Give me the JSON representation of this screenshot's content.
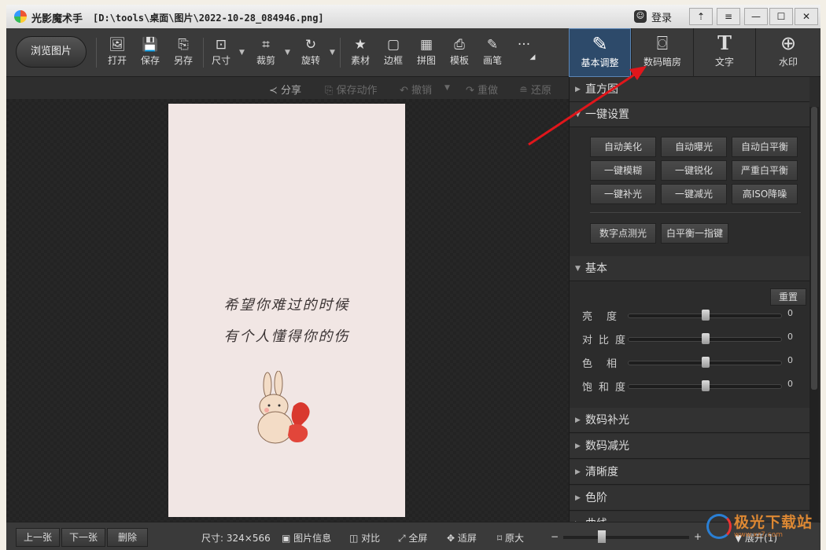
{
  "titlebar": {
    "app_name": "光影魔术手",
    "file_path": "[D:\\tools\\桌面\\图片\\2022-10-28_084946.png]",
    "login_label": "登录",
    "window_buttons": [
      "⇡",
      "≡",
      "—",
      "☐",
      "✕"
    ]
  },
  "toolbar": {
    "browse_label": "浏览图片",
    "tools": [
      {
        "label": "打开",
        "icon": "🖼"
      },
      {
        "label": "保存",
        "icon": "💾"
      },
      {
        "label": "另存",
        "icon": "⎘"
      },
      {
        "label": "尺寸",
        "icon": "⊡"
      },
      {
        "label": "裁剪",
        "icon": "⌗"
      },
      {
        "label": "旋转",
        "icon": "↻"
      },
      {
        "label": "素材",
        "icon": "★"
      },
      {
        "label": "边框",
        "icon": "▢"
      },
      {
        "label": "拼图",
        "icon": "▦"
      },
      {
        "label": "模板",
        "icon": "⎙"
      },
      {
        "label": "画笔",
        "icon": "✎"
      }
    ],
    "more_icon": "···",
    "right_tabs": [
      {
        "label": "基本调整",
        "icon": "✎"
      },
      {
        "label": "数码暗房",
        "icon": "⌼"
      },
      {
        "label": "文字",
        "icon": "T"
      },
      {
        "label": "水印",
        "icon": "⊕"
      }
    ]
  },
  "actionbar": {
    "share": "分享",
    "save_action": "保存动作",
    "undo": "撤销",
    "redo": "重做",
    "restore": "还原"
  },
  "photo": {
    "line1": "希望你难过的时候",
    "line2": "有个人懂得你的伤"
  },
  "panel": {
    "histogram": "直方图",
    "one_click": "一键设置",
    "one_click_buttons": [
      "自动美化",
      "自动曝光",
      "自动白平衡",
      "一键模糊",
      "一键锐化",
      "严重白平衡",
      "一键补光",
      "一键减光",
      "高ISO降噪"
    ],
    "extra_buttons": [
      "数字点测光",
      "白平衡一指键"
    ],
    "basic": "基本",
    "reset": "重置",
    "sliders": [
      {
        "label": "亮度",
        "value": "0"
      },
      {
        "label": "对比度",
        "value": "0"
      },
      {
        "label": "色相",
        "value": "0"
      },
      {
        "label": "饱和度",
        "value": "0"
      }
    ],
    "sections": [
      "数码补光",
      "数码减光",
      "清晰度",
      "色阶",
      "曲线"
    ]
  },
  "bottombar": {
    "prev": "上一张",
    "next": "下一张",
    "delete": "删除",
    "size_info": "尺寸: 324×566",
    "photo_info": "图片信息",
    "compare": "对比",
    "fullscreen": "全屏",
    "fit": "适屏",
    "original": "原大",
    "expand": "展开(1)"
  },
  "watermark": {
    "text": "极光下载站",
    "url": "www.xz7.com"
  }
}
